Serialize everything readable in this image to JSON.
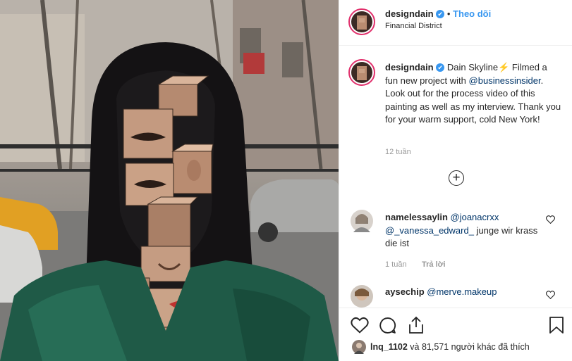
{
  "header": {
    "username": "designdain",
    "verified_mark": "✔",
    "separator": "•",
    "follow_label": "Theo dõi",
    "location": "Financial District"
  },
  "caption": {
    "username": "designdain",
    "verified_mark": "✔",
    "text_before": "Dain Skyline⚡ Filmed a fun new project with",
    "mention": "@businessinsider",
    "text_after": ". Look out for the process video of this painting as well as my interview. Thank you for your warm support, cold New York!",
    "time": "12 tuần"
  },
  "load_more": {
    "icon": "plus-circle-icon",
    "symbol": "+"
  },
  "comments": [
    {
      "username": "namelessaylin",
      "mention1": "@joanacrxx",
      "mention2": "@_vanessa_edward_",
      "text": " junge wir krass die ist",
      "time": "1 tuần",
      "reply_label": "Trả lời"
    },
    {
      "username": "aysechip",
      "mention1": "@merve.makeup"
    }
  ],
  "actions": {
    "like_icon": "heart-icon",
    "comment_icon": "comment-icon",
    "share_icon": "share-icon",
    "save_icon": "bookmark-icon"
  },
  "likes": {
    "first_user": "lnq_1102",
    "text": " và 81,571 người khác đã thích"
  },
  "colors": {
    "accent": "#3897f0",
    "ring": "#e1306c",
    "mention": "#003569"
  }
}
